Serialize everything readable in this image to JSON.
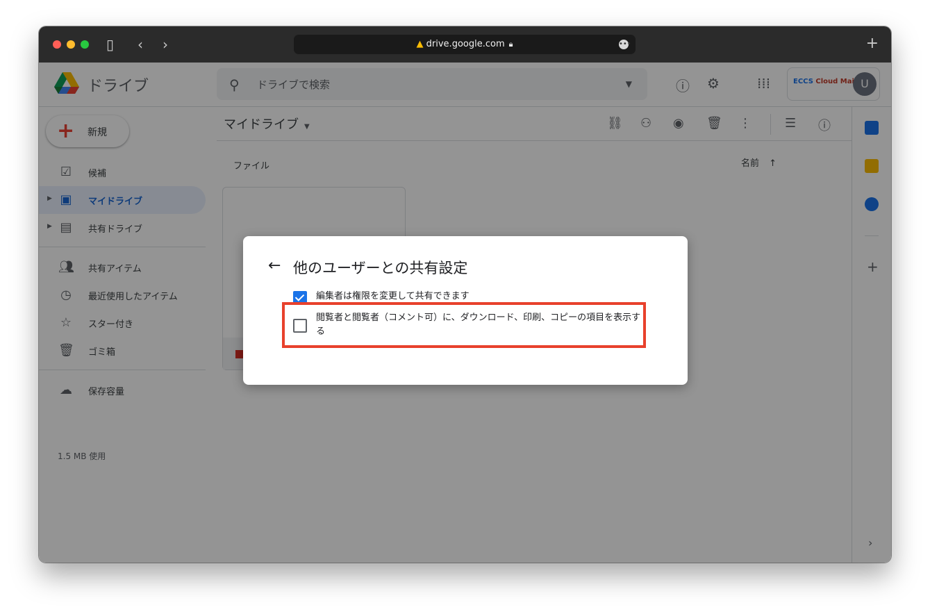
{
  "browser": {
    "url": "drive.google.com",
    "new_tab": "+"
  },
  "header": {
    "app_title": "ドライブ",
    "search_placeholder": "ドライブで検索",
    "account_brand_a": "ECCS",
    "account_brand_b": "Cloud Mail",
    "avatar_initial": "U"
  },
  "sidebar": {
    "new_label": "新規",
    "items": [
      {
        "label": "候補"
      },
      {
        "label": "マイドライブ"
      },
      {
        "label": "共有ドライブ"
      },
      {
        "label": "共有アイテム"
      },
      {
        "label": "最近使用したアイテム"
      },
      {
        "label": "スター付き"
      },
      {
        "label": "ゴミ箱"
      },
      {
        "label": "保存容量"
      }
    ],
    "storage_usage": "1.5 MB 使用"
  },
  "main": {
    "breadcrumb": "マイドライブ",
    "files_header": "ファイル",
    "sort_label": "名前"
  },
  "dialog": {
    "title": "他のユーザーとの共有設定",
    "option1_label": "編集者は権限を変更して共有できます",
    "option1_checked": true,
    "option2_label": "閲覧者と閲覧者（コメント可）に、ダウンロード、印刷、コピーの項目を表示する",
    "option2_checked": false
  },
  "colors": {
    "highlight": "#e8412c",
    "accent": "#1a73e8",
    "active_nav": "#e8f0fe"
  }
}
